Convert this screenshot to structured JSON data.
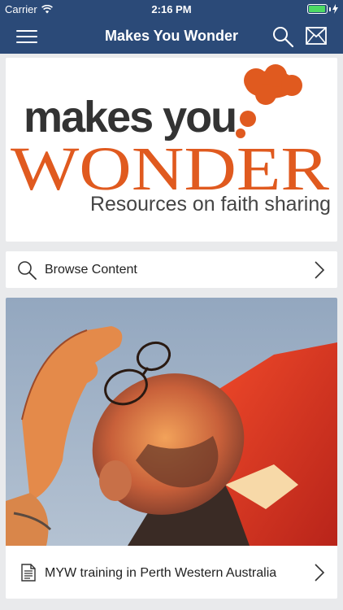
{
  "status_bar": {
    "carrier": "Carrier",
    "time": "2:16 PM",
    "battery_level": 0.95
  },
  "nav": {
    "title": "Makes You Wonder",
    "menu_icon": "hamburger-menu-icon",
    "search_icon": "search-icon",
    "mail_icon": "mail-icon",
    "background": "#2b4a78"
  },
  "logo": {
    "line1": "makes you",
    "line2": "WONDER",
    "tagline": "Resources on faith sharing",
    "accent_color": "#e05a1f",
    "dark_color": "#333333"
  },
  "browse": {
    "label": "Browse Content",
    "icon": "search-icon"
  },
  "feature": {
    "label": "MYW training in Perth Western Australia",
    "icon": "document-icon"
  }
}
